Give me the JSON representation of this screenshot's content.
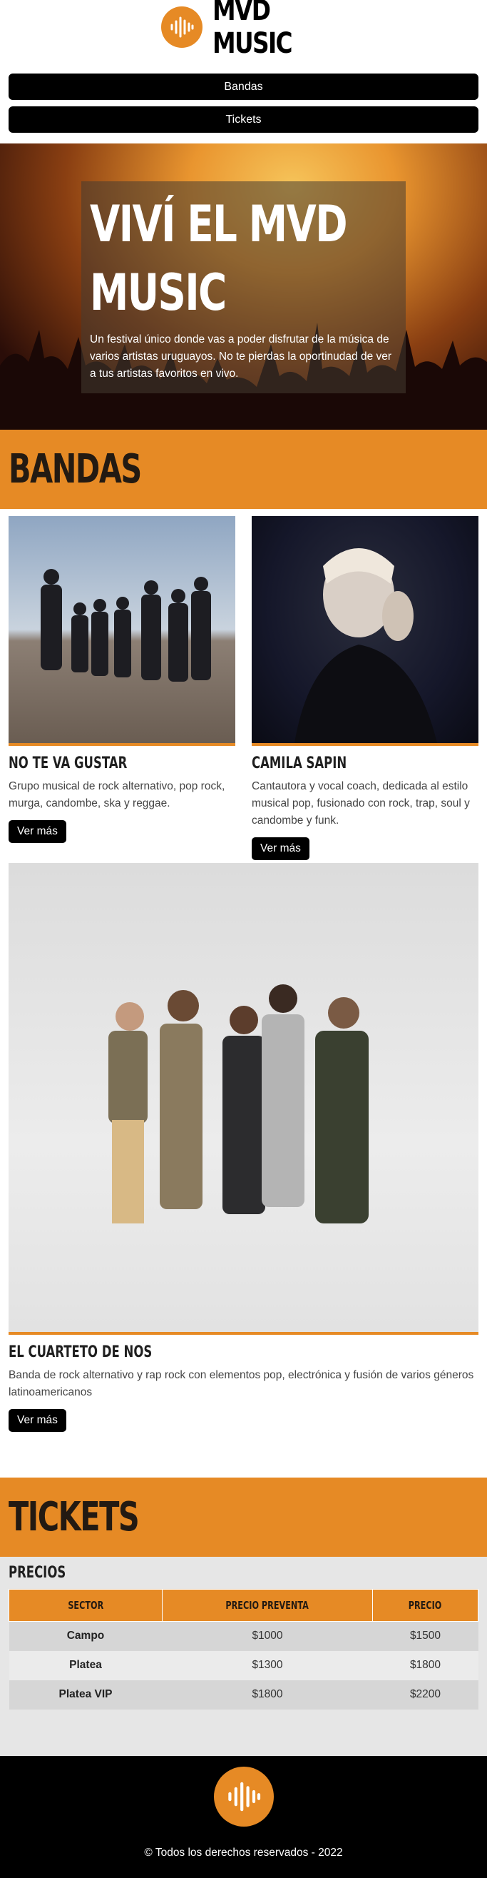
{
  "header": {
    "brand": "MVD MUSIC",
    "logo_icon": "sound-wave-icon"
  },
  "nav": {
    "items": [
      {
        "label": "Bandas"
      },
      {
        "label": "Tickets"
      }
    ]
  },
  "hero": {
    "title_line1": "VIVÍ EL MVD",
    "title_line2": "MUSIC",
    "text": "Un festival único donde vas a poder disfrutar de la música de varios artistas uruguayos. No te pierdas la oportinudad de ver a tus artistas favoritos en vivo."
  },
  "bands_section": {
    "title": "BANDAS",
    "bands": [
      {
        "name": "NO TE VA GUSTAR",
        "description": "Grupo musical de rock alternativo, pop rock, murga, candombe, ska y reggae.",
        "button": "Ver más"
      },
      {
        "name": "CAMILA SAPIN",
        "description": "Cantautora y vocal coach, dedicada al estilo musical pop, fusionado con rock, trap, soul y candombe y funk.",
        "button": "Ver más"
      },
      {
        "name": "EL CUARTETO DE NOS",
        "description": "Banda de rock alternativo y rap rock con elementos pop, electrónica y fusión de varios géneros latinoamericanos",
        "button": "Ver más"
      }
    ]
  },
  "tickets_section": {
    "title": "TICKETS",
    "subtitle": "PRECIOS",
    "headers": [
      "SECTOR",
      "PRECIO PREVENTA",
      "PRECIO"
    ],
    "rows": [
      [
        "Campo",
        "$1000",
        "$1500"
      ],
      [
        "Platea",
        "$1300",
        "$1800"
      ],
      [
        "Platea VIP",
        "$1800",
        "$2200"
      ]
    ]
  },
  "footer": {
    "copyright": "© Todos los derechos reservados - 2022",
    "logo_icon": "sound-wave-icon"
  },
  "colors": {
    "accent": "#e68a25",
    "dark": "#000000",
    "table_bg": "#e6e6e6"
  }
}
